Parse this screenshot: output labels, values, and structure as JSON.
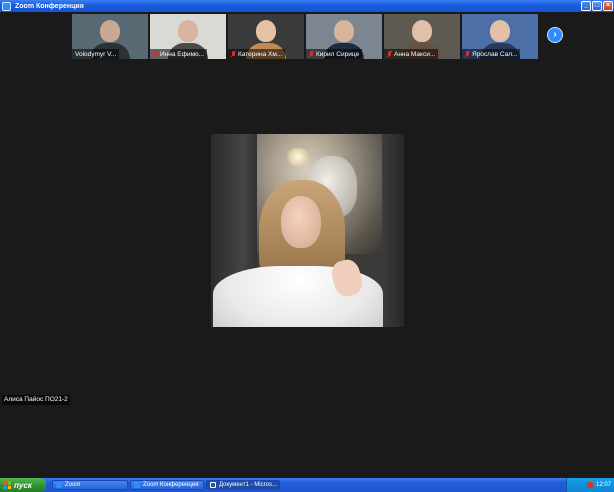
{
  "window": {
    "title": "Zoom Конференция",
    "controls": {
      "minimize": "_",
      "maximize": "□",
      "close": "×"
    }
  },
  "thumbnails": [
    {
      "name": "Volodymyr V...",
      "bg": "#5a6a74",
      "skin": "#c9a994",
      "clothes": "#2c3138",
      "muted": false
    },
    {
      "name": "Инна Ефимо...",
      "bg": "#d9d9d6",
      "skin": "#d8b39d",
      "clothes": "#4a4a4a",
      "muted": true
    },
    {
      "name": "Катерина Хм...",
      "bg": "#3a3a3a",
      "skin": "#e6c1a4",
      "clothes": "#c08a52",
      "muted": true
    },
    {
      "name": "Кирил Сирице",
      "bg": "#7c8690",
      "skin": "#d8b49c",
      "clothes": "#1f2a3a",
      "muted": true
    },
    {
      "name": "Анна Макси...",
      "bg": "#5e5a52",
      "skin": "#e1bfa8",
      "clothes": "#6a5040",
      "muted": true
    },
    {
      "name": "Ярослав Сал...",
      "bg": "#4d6fa8",
      "skin": "#e4c0a6",
      "clothes": "#2a3a5a",
      "muted": true
    }
  ],
  "speaker": {
    "name": "Алиса Пайос ПО21-2"
  },
  "taskbar": {
    "start_label": "пуск",
    "tasks": [
      {
        "label": "Zoom",
        "icon_color": "#2d8cff",
        "active": false
      },
      {
        "label": "Zoom Конференция",
        "icon_color": "#2d8cff",
        "active": false
      },
      {
        "label": "Документ1 - Micros...",
        "icon_color": "#2b579a",
        "active": true
      }
    ],
    "language": "UK",
    "clock": "12:07"
  }
}
